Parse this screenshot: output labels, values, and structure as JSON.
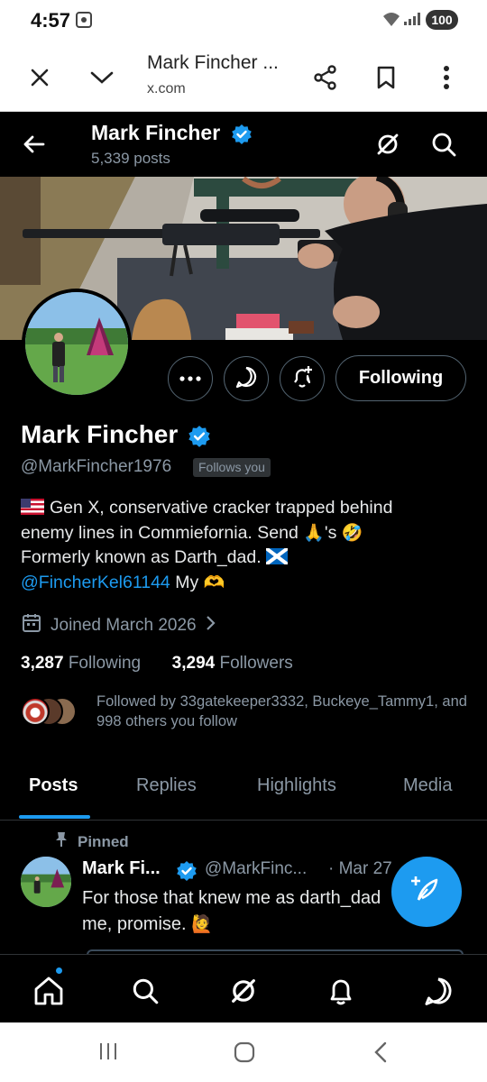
{
  "status_bar": {
    "time": "4:57",
    "battery": "100"
  },
  "browser": {
    "title": "Mark Fincher ...",
    "url": "x.com",
    "icons": [
      "close-icon",
      "chevron-down-icon",
      "share-icon",
      "bookmark-icon",
      "more-vert-icon"
    ]
  },
  "header": {
    "name": "Mark Fincher",
    "posts_count": "5,339 posts",
    "icons": [
      "back-arrow-icon",
      "grok-icon",
      "search-icon"
    ]
  },
  "profile": {
    "name": "Mark Fincher",
    "handle": "@MarkFincher1976",
    "follows_you": "Follows you",
    "following_button": "Following",
    "bio": {
      "line1": "Gen X, conservative cracker trapped behind",
      "line2_a": "enemy lines in Commiefornia. Send",
      "line2_b": "'s",
      "line3": "Formerly known as Darth_dad.",
      "mention": "@FincherKel61144",
      "line4_tail": "My"
    },
    "joined": "Joined March 2026",
    "following_count": "3,287",
    "following_label": "Following",
    "followers_count": "3,294",
    "followers_label": "Followers",
    "followed_by": "Followed by 33gatekeeper3332, Buckeye_Tammy1, and 998 others you follow"
  },
  "tabs": [
    "Posts",
    "Replies",
    "Highlights",
    "Media"
  ],
  "active_tab": "Posts",
  "pinned_post": {
    "pinned_label": "Pinned",
    "name": "Mark Fi...",
    "handle": "@MarkFinc...",
    "date": "· Mar 27",
    "text_line1": "For those that knew me as darth_dad",
    "text_line2": "me, promise."
  },
  "colors": {
    "accent": "#1d9bf0",
    "background": "#000000",
    "muted": "#8b98a5"
  }
}
